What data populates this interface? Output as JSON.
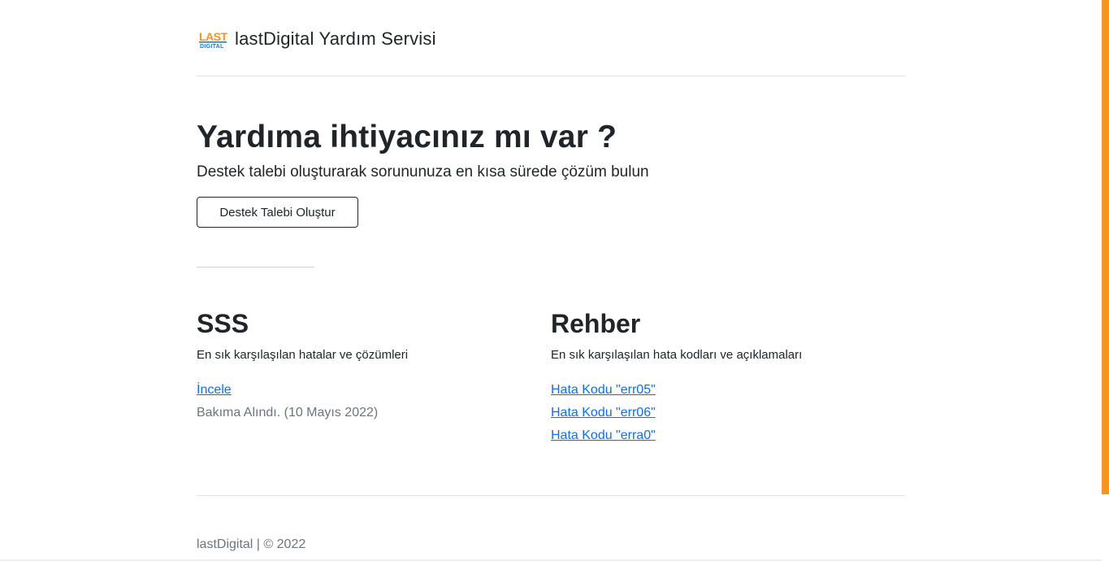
{
  "header": {
    "logo_alt": "LAST DIGITAL",
    "brand": "lastDigital Yardım Servisi"
  },
  "hero": {
    "title": "Yardıma ihtiyacınız mı var ?",
    "subtitle": "Destek talebi oluşturarak sorununuza en kısa sürede çözüm bulun",
    "button_label": "Destek Talebi Oluştur"
  },
  "faq": {
    "title": "SSS",
    "description": "En sık karşılaşılan hatalar ve çözümleri",
    "link": "İncele",
    "note": "Bakıma Alındı. (10 Mayıs 2022)"
  },
  "guide": {
    "title": "Rehber",
    "description": "En sık karşılaşılan hata kodları ve açıklamaları",
    "links": [
      "Hata Kodu \"err05\"",
      "Hata Kodu \"err06\"",
      "Hata Kodu \"erra0\""
    ]
  },
  "footer": {
    "text": "lastDigital | © 2022"
  },
  "colors": {
    "accent": "#f7941d",
    "link": "#0d6efd",
    "logo_orange": "#f7941d",
    "logo_blue": "#1a75bb"
  }
}
